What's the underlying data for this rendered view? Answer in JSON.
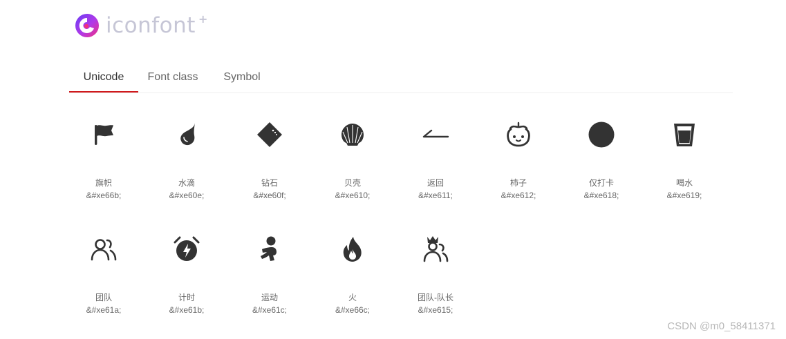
{
  "logo": {
    "text": "iconfont",
    "plus": "+"
  },
  "tabs": [
    {
      "label": "Unicode",
      "active": true
    },
    {
      "label": "Font class",
      "active": false
    },
    {
      "label": "Symbol",
      "active": false
    }
  ],
  "icons": [
    {
      "name": "旗帜",
      "code": "&#xe66b;",
      "icon": "flag-icon"
    },
    {
      "name": "水滴",
      "code": "&#xe60e;",
      "icon": "water-drop-icon"
    },
    {
      "name": "钻石",
      "code": "&#xe60f;",
      "icon": "diamond-icon"
    },
    {
      "name": "贝壳",
      "code": "&#xe610;",
      "icon": "shell-icon"
    },
    {
      "name": "返回",
      "code": "&#xe611;",
      "icon": "back-icon"
    },
    {
      "name": "柿子",
      "code": "&#xe612;",
      "icon": "persimmon-icon"
    },
    {
      "name": "仅打卡",
      "code": "&#xe618;",
      "icon": "check-in-icon"
    },
    {
      "name": "喝水",
      "code": "&#xe619;",
      "icon": "drink-water-icon"
    },
    {
      "name": "团队",
      "code": "&#xe61a;",
      "icon": "team-icon"
    },
    {
      "name": "计时",
      "code": "&#xe61b;",
      "icon": "timer-icon"
    },
    {
      "name": "运动",
      "code": "&#xe61c;",
      "icon": "sport-icon"
    },
    {
      "name": "火",
      "code": "&#xe66c;",
      "icon": "fire-icon"
    },
    {
      "name": "团队-队长",
      "code": "&#xe615;",
      "icon": "team-leader-icon"
    }
  ],
  "watermark": "CSDN @m0_58411371",
  "colors": {
    "accent": "#d0191c",
    "icon": "#333333",
    "logo_text": "#c6c6d6"
  }
}
